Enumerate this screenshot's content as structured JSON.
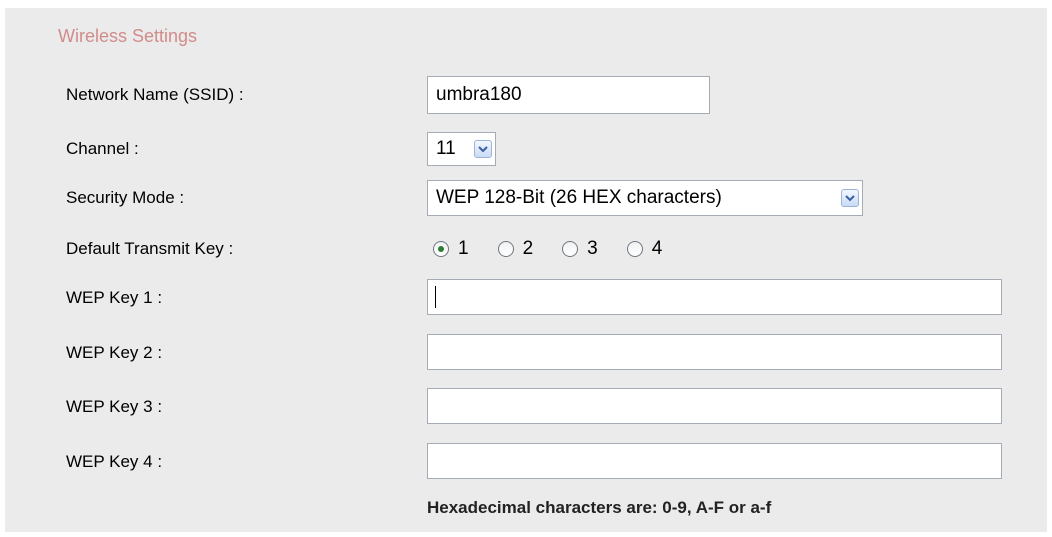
{
  "section_title": "Wireless Settings",
  "ssid": {
    "label": "Network Name (SSID) :",
    "value": "umbra180"
  },
  "channel": {
    "label": "Channel :",
    "value": "11"
  },
  "security_mode": {
    "label": "Security Mode :",
    "value": "WEP 128-Bit (26 HEX characters)"
  },
  "transmit_key": {
    "label": "Default Transmit Key :",
    "options": [
      "1",
      "2",
      "3",
      "4"
    ],
    "selected": "1"
  },
  "wep_keys": [
    {
      "label": "WEP Key 1 :",
      "value": ""
    },
    {
      "label": "WEP Key 2 :",
      "value": ""
    },
    {
      "label": "WEP Key 3 :",
      "value": ""
    },
    {
      "label": "WEP Key 4 :",
      "value": ""
    }
  ],
  "hint": "Hexadecimal characters are: 0-9, A-F or a-f",
  "colors": {
    "panel_bg": "#ebebeb",
    "section_title": "#d28b8b",
    "radio_checked": "#2e7d32"
  },
  "icons": {
    "dropdown": "chevron-down-icon",
    "radio": "radio-icon"
  }
}
